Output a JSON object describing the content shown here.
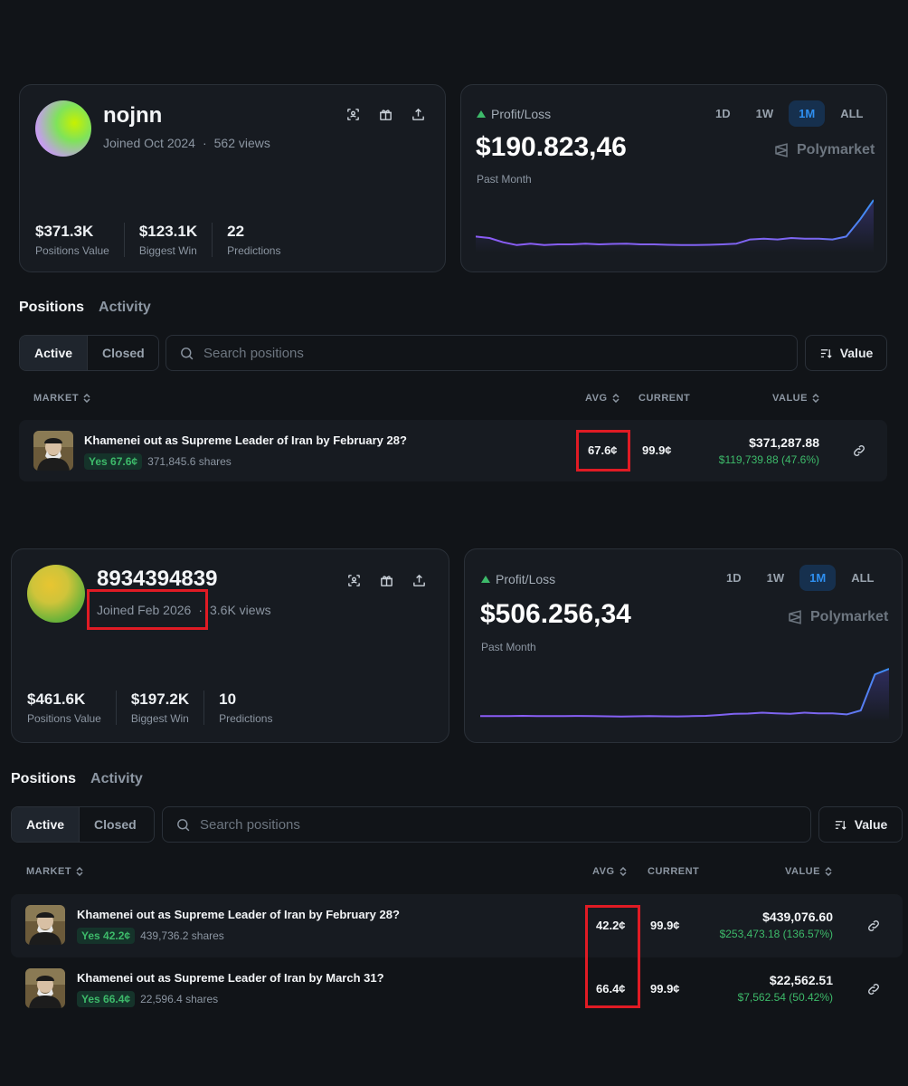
{
  "profiles": [
    {
      "username": "nojnn",
      "joined": "Joined Oct 2024",
      "views": "562 views",
      "stats": [
        {
          "value": "$371.3K",
          "label": "Positions Value"
        },
        {
          "value": "$123.1K",
          "label": "Biggest Win"
        },
        {
          "value": "22",
          "label": "Predictions"
        }
      ],
      "pl_label": "Profit/Loss",
      "pl_value": "$190.823,46",
      "pl_period": "Past Month",
      "ranges": [
        "1D",
        "1W",
        "1M",
        "ALL"
      ],
      "selected_range": "1M",
      "brand": "Polymarket",
      "tabs": [
        "Positions",
        "Activity"
      ],
      "filters": [
        "Active",
        "Closed"
      ],
      "search_placeholder": "Search positions",
      "sort_label": "Value",
      "columns": {
        "market": "MARKET",
        "avg": "AVG",
        "current": "CURRENT",
        "value": "VALUE"
      },
      "rows": [
        {
          "title": "Khamenei out as Supreme Leader of Iran by February 28?",
          "badge": "Yes 67.6¢",
          "shares": "371,845.6 shares",
          "avg": "67.6¢",
          "current": "99.9¢",
          "value": "$371,287.88",
          "pnl": "$119,739.88 (47.6%)"
        }
      ]
    },
    {
      "username": "8934394839",
      "joined": "Joined Feb 2026",
      "views": "3.6K views",
      "stats": [
        {
          "value": "$461.6K",
          "label": "Positions Value"
        },
        {
          "value": "$197.2K",
          "label": "Biggest Win"
        },
        {
          "value": "10",
          "label": "Predictions"
        }
      ],
      "pl_label": "Profit/Loss",
      "pl_value": "$506.256,34",
      "pl_period": "Past Month",
      "ranges": [
        "1D",
        "1W",
        "1M",
        "ALL"
      ],
      "selected_range": "1M",
      "brand": "Polymarket",
      "tabs": [
        "Positions",
        "Activity"
      ],
      "filters": [
        "Active",
        "Closed"
      ],
      "search_placeholder": "Search positions",
      "sort_label": "Value",
      "columns": {
        "market": "MARKET",
        "avg": "AVG",
        "current": "CURRENT",
        "value": "VALUE"
      },
      "rows": [
        {
          "title": "Khamenei out as Supreme Leader of Iran by February 28?",
          "badge": "Yes 42.2¢",
          "shares": "439,736.2 shares",
          "avg": "42.2¢",
          "current": "99.9¢",
          "value": "$439,076.60",
          "pnl": "$253,473.18 (136.57%)"
        },
        {
          "title": "Khamenei out as Supreme Leader of Iran by March 31?",
          "badge": "Yes 66.4¢",
          "shares": "22,596.4 shares",
          "avg": "66.4¢",
          "current": "99.9¢",
          "value": "$22,562.51",
          "pnl": "$7,562.54 (50.42%)"
        }
      ]
    }
  ],
  "colors": {
    "background": "#111418",
    "card": "#171b21",
    "accent_blue": "#2e8ff0",
    "profit_green": "#3dba6a",
    "chart_purple": "#8b5cf6",
    "highlight_red": "#e01b24"
  },
  "icons": [
    "scan-icon",
    "gift-icon",
    "share-icon",
    "polymarket-logo-icon",
    "search-icon",
    "sort-icon",
    "sort-chevron-icon",
    "link-icon"
  ],
  "chart_data": [
    {
      "type": "area",
      "x": [
        0,
        1,
        2,
        3,
        4,
        5,
        6,
        7,
        8,
        9,
        10,
        11,
        12,
        13,
        14,
        15,
        16,
        17,
        18,
        19,
        20,
        21,
        22,
        23,
        24,
        25,
        26,
        27,
        28,
        29
      ],
      "series": [
        {
          "values": [
            10,
            9,
            6,
            4,
            5,
            4,
            4.5,
            4.5,
            5,
            4.5,
            4.8,
            5,
            4.5,
            4.5,
            4.2,
            4,
            4,
            4.2,
            4.5,
            5,
            8,
            8.5,
            8,
            9,
            8.5,
            8.5,
            8,
            10,
            22,
            36
          ]
        }
      ],
      "title": "",
      "xlabel": "",
      "ylabel": ""
    },
    {
      "type": "area",
      "x": [
        0,
        1,
        2,
        3,
        4,
        5,
        6,
        7,
        8,
        9,
        10,
        11,
        12,
        13,
        14,
        15,
        16,
        17,
        18,
        19,
        20,
        21,
        22,
        23,
        24,
        25,
        26,
        27,
        28,
        29
      ],
      "series": [
        {
          "values": [
            3,
            3,
            3,
            3.2,
            3,
            3,
            3,
            3.1,
            3,
            2.8,
            2.6,
            2.8,
            3,
            2.8,
            2.7,
            3,
            3.2,
            4,
            5,
            5.2,
            6,
            5.5,
            5,
            6,
            5.5,
            5.5,
            4.5,
            8,
            40,
            45
          ]
        }
      ],
      "title": "",
      "xlabel": "",
      "ylabel": ""
    }
  ]
}
